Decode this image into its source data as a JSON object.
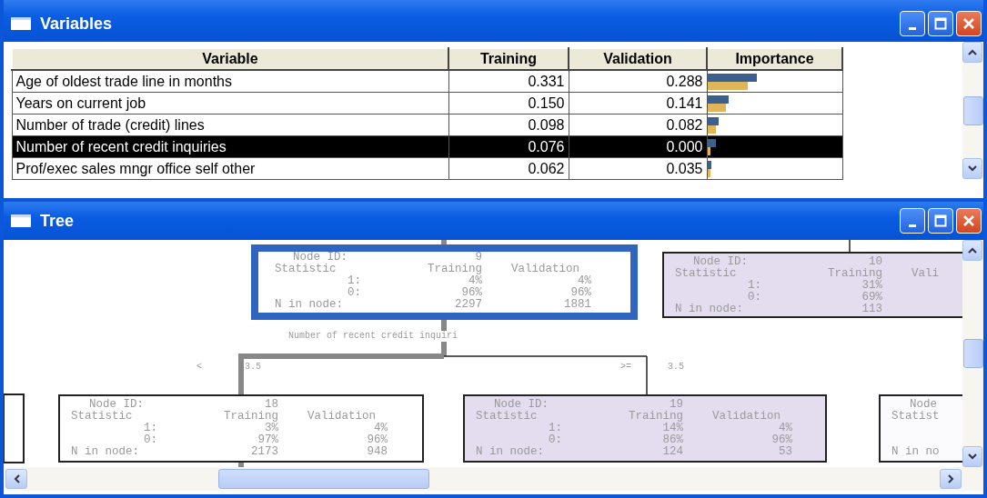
{
  "variables_window": {
    "title": "Variables",
    "columns": [
      "Variable",
      "Training",
      "Validation",
      "Importance"
    ],
    "rows": [
      {
        "variable": "Age of oldest trade line in months",
        "training": "0.331",
        "validation": "0.288",
        "selected": false,
        "importance_bars": [
          {
            "kind": "training",
            "level": 0.35
          },
          {
            "kind": "validation",
            "level": 0.29
          }
        ]
      },
      {
        "variable": "Years on current job",
        "training": "0.150",
        "validation": "0.141",
        "selected": false,
        "importance_bars": [
          {
            "kind": "training",
            "level": 0.15
          },
          {
            "kind": "validation",
            "level": 0.13
          }
        ]
      },
      {
        "variable": "Number of trade (credit) lines",
        "training": "0.098",
        "validation": "0.082",
        "selected": false,
        "importance_bars": [
          {
            "kind": "training",
            "level": 0.08
          },
          {
            "kind": "validation",
            "level": 0.06
          }
        ]
      },
      {
        "variable": "Number of recent credit inquiries",
        "training": "0.076",
        "validation": "0.000",
        "selected": true,
        "importance_bars": [
          {
            "kind": "training",
            "level": 0.06
          },
          {
            "kind": "validation",
            "level": 0.0
          }
        ]
      },
      {
        "variable": "Prof/exec sales mngr office self other",
        "training": "0.062",
        "validation": "0.035",
        "selected": false,
        "importance_bars": [
          {
            "kind": "training",
            "level": 0.03
          },
          {
            "kind": "validation",
            "level": 0.02
          }
        ]
      }
    ]
  },
  "tree_window": {
    "title": "Tree",
    "nodes": [
      {
        "id_label": "Node ID:",
        "id": "9",
        "header": [
          "Statistic",
          "Training",
          "Validation"
        ],
        "rows": [
          [
            "1:",
            "4%",
            "4%"
          ],
          [
            "0:",
            "96%",
            "96%"
          ],
          [
            "N in node:",
            "2297",
            "1881"
          ]
        ],
        "selected": true,
        "color": "#ffffff"
      },
      {
        "id_label": "Node ID:",
        "id": "10",
        "header": [
          "Statistic",
          "Training",
          "Vali"
        ],
        "rows": [
          [
            "1:",
            "31%"
          ],
          [
            "0:",
            "69%"
          ],
          [
            "N in node:",
            "113"
          ]
        ],
        "selected": false,
        "color": "#e3ddef"
      },
      {
        "id_label": "Node ID:",
        "id": "18",
        "header": [
          "Statistic",
          "Training",
          "Validation"
        ],
        "rows": [
          [
            "1:",
            "3%",
            "4%"
          ],
          [
            "0:",
            "97%",
            "96%"
          ],
          [
            "N in node:",
            "2173",
            "948"
          ]
        ],
        "selected": false,
        "color": "#ffffff"
      },
      {
        "id_label": "Node ID:",
        "id": "19",
        "header": [
          "Statistic",
          "Training",
          "Validation"
        ],
        "rows": [
          [
            "1:",
            "14%",
            "4%"
          ],
          [
            "0:",
            "86%",
            "96%"
          ],
          [
            "N in node:",
            "124",
            "53"
          ]
        ],
        "selected": false,
        "color": "#e3ddef"
      },
      {
        "id_label": "Node",
        "header": [
          "Statist"
        ],
        "rows": [
          [
            "N in no"
          ]
        ],
        "selected": false,
        "color": "#fbfbfd"
      }
    ],
    "split_label": "Number of recent credit inquiri",
    "branches": [
      {
        "op": "<",
        "value": "3.5"
      },
      {
        "op": ">=",
        "value": "3.5"
      }
    ]
  }
}
